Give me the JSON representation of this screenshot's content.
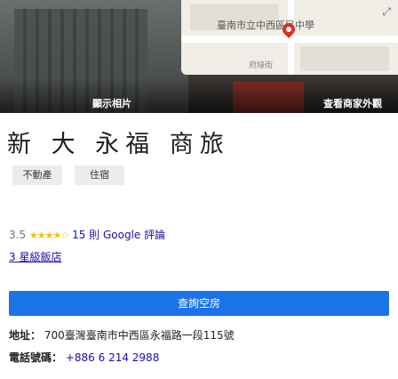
{
  "photos": {
    "left_caption": "顯示相片",
    "right_caption": "查看商家外觀"
  },
  "map": {
    "label": "臺南市立中西區民中學",
    "sublabel": "府綠街"
  },
  "business": {
    "name": "新 大 永福 商旅",
    "chips": [
      "不動產",
      "住宿"
    ]
  },
  "rating": {
    "score": "3.5",
    "stars": "★★★★☆",
    "reviews_link": "15 則 Google 評論"
  },
  "price": {
    "label": "3 星級飯店"
  },
  "actions": {
    "book_label": "查詢空房"
  },
  "details": {
    "address_label": "地址：",
    "address_value": "700臺灣臺南市中西區永福路一段115號",
    "phone_label": "電話號碼：",
    "phone_value": "+886 6 214 2988"
  }
}
